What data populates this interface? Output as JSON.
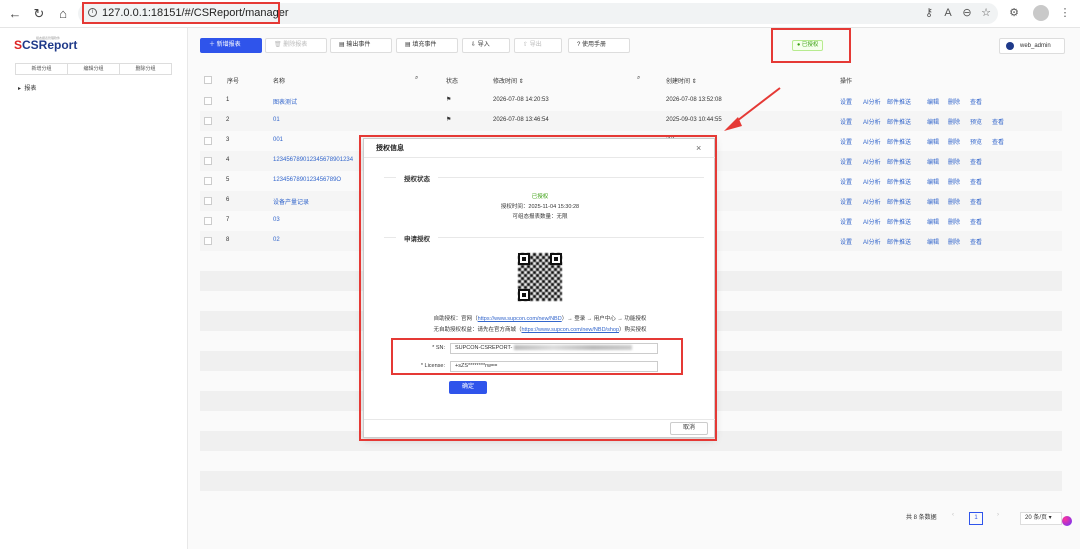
{
  "browser": {
    "url": "127.0.0.1:18151/#/CSReport/manager"
  },
  "app": {
    "logo_prefix": "S",
    "logo_text": "CSReport",
    "logo_subtitle": "组态报表管理软件",
    "sidebar": {
      "segments": [
        "新增分组",
        "编辑分组",
        "删除分组"
      ],
      "tree_root": "报表"
    },
    "toolbar": {
      "new": "新增报表",
      "delete": "删除报表",
      "export_event": "输出事件",
      "fill_event": "填充事件",
      "import": "导入",
      "export": "导出",
      "manual": "使用手册"
    },
    "auth_tag": "已授权",
    "user": "web_admin",
    "table": {
      "headers": {
        "index": "序号",
        "name": "名称",
        "status": "状态",
        "modified": "修改时间",
        "created": "创建时间",
        "actions": "操作"
      },
      "rows": [
        {
          "index": "1",
          "name": "图表测试",
          "modified": "2026-07-08 14:20:53",
          "created": "2026-07-08 13:52:08",
          "actions": [
            "设置",
            "AI分析",
            "邮件推送",
            "编辑",
            "删除",
            "查看"
          ]
        },
        {
          "index": "2",
          "name": "01",
          "modified": "2026-07-08 13:46:54",
          "created": "2025-09-03 10:44:55",
          "actions": [
            "设置",
            "AI分析",
            "邮件推送",
            "编辑",
            "删除",
            "预览",
            "查看"
          ]
        },
        {
          "index": "3",
          "name": "001",
          "modified": "",
          "created": ":13",
          "actions": [
            "设置",
            "AI分析",
            "邮件推送",
            "编辑",
            "删除",
            "预览",
            "查看"
          ]
        },
        {
          "index": "4",
          "name": "123456789012345678901234",
          "modified": "",
          "created": ":59",
          "actions": [
            "设置",
            "AI分析",
            "邮件推送",
            "编辑",
            "删除",
            "查看"
          ]
        },
        {
          "index": "5",
          "name": "1234567890123456789O",
          "modified": "",
          "created": ":05",
          "actions": [
            "设置",
            "AI分析",
            "邮件推送",
            "编辑",
            "删除",
            "查看"
          ]
        },
        {
          "index": "6",
          "name": "设备产量记录",
          "modified": "",
          "created": ":15",
          "actions": [
            "设置",
            "AI分析",
            "邮件推送",
            "编辑",
            "删除",
            "查看"
          ]
        },
        {
          "index": "7",
          "name": "03",
          "modified": "",
          "created": ":37",
          "actions": [
            "设置",
            "AI分析",
            "邮件推送",
            "编辑",
            "删除",
            "查看"
          ]
        },
        {
          "index": "8",
          "name": "02",
          "modified": "",
          "created": ":02",
          "actions": [
            "设置",
            "AI分析",
            "邮件推送",
            "编辑",
            "删除",
            "查看"
          ]
        }
      ]
    },
    "pagination": {
      "total": "共 8 条数据",
      "current_page": "1",
      "page_size": "20 条/页"
    }
  },
  "modal": {
    "title": "授权信息",
    "status_section": "授权状态",
    "status_value": "已授权",
    "auth_time": "授权时间：2025-11-04 15:30:28",
    "report_count": "可组态报表数量：无限",
    "apply_section": "申请授权",
    "self_auth_prefix": "自助授权：官网（",
    "self_auth_link": "https://www.supcon.com/new/NBD",
    "self_auth_suffix": "）→ 登录 → 用户中心 → 功能授权",
    "no_auth_prefix": "无自助授权权益：请先在官方商城（",
    "no_auth_link": "https://www.supcon.com/new/NBD/shop",
    "no_auth_suffix": "）购买授权",
    "sn_label": "* SN:",
    "sn_value": "SUPCON-CSREPORT-",
    "license_label": "* License:",
    "license_value": "+sZS********rw==",
    "confirm": "确定",
    "cancel": "取消"
  },
  "colors": {
    "primary": "#2f54eb",
    "highlight": "#e53935",
    "success": "#389e0d",
    "link": "#3366cc"
  }
}
